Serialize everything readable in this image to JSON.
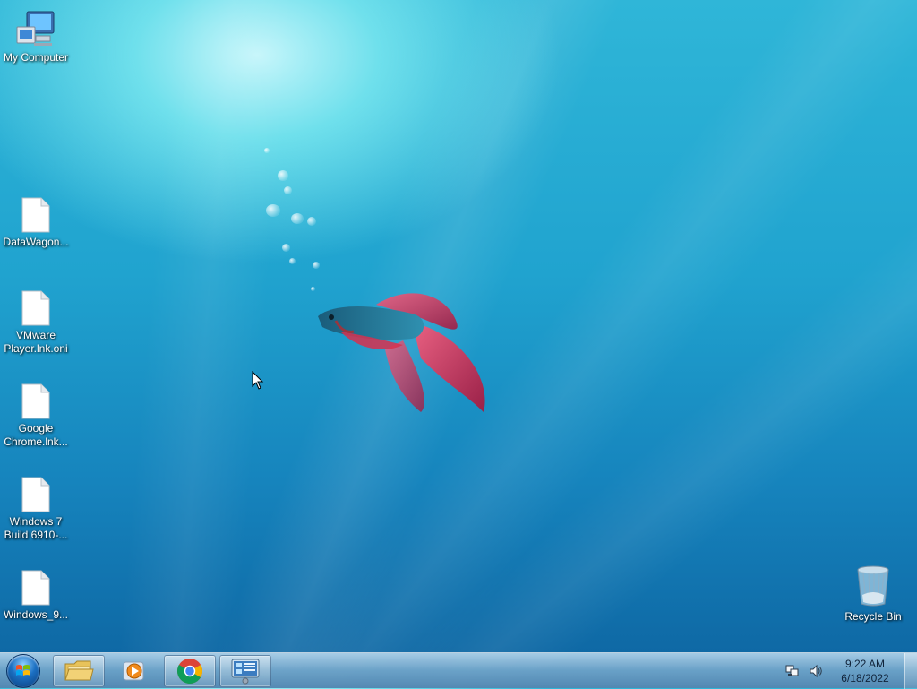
{
  "desktop": {
    "icons": [
      {
        "name": "My Computer",
        "type": "computer"
      },
      {
        "name": "DataWagon...",
        "type": "file"
      },
      {
        "name": "VMware Player.lnk.oni",
        "type": "file"
      },
      {
        "name": "Google Chrome.lnk...",
        "type": "file"
      },
      {
        "name": "Windows 7 Build 6910-...",
        "type": "file"
      },
      {
        "name": "Windows_9...",
        "type": "file"
      },
      {
        "name": "Recycle Bin",
        "type": "recycle-bin"
      }
    ]
  },
  "taskbar": {
    "pinned": [
      {
        "name": "Windows Explorer",
        "icon": "folder-icon"
      },
      {
        "name": "Windows Media Player",
        "icon": "media-player-icon"
      },
      {
        "name": "Google Chrome",
        "icon": "chrome-icon"
      },
      {
        "name": "Remote Desktop",
        "icon": "remote-desktop-icon"
      }
    ],
    "tray": {
      "time": "9:22 AM",
      "date": "6/18/2022"
    }
  },
  "colors": {
    "accent": "#1684bd",
    "taskbar": "#7aaacf"
  }
}
